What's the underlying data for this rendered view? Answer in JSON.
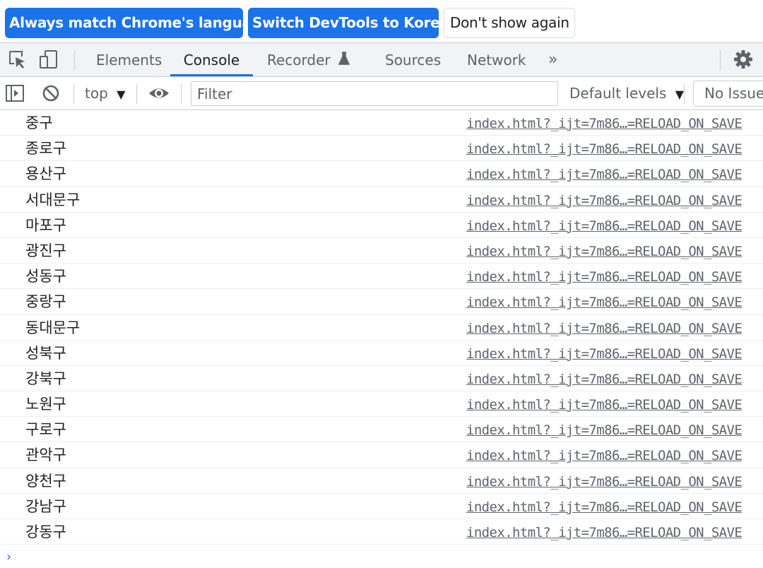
{
  "infobar": {
    "match_label": "Always match Chrome's language",
    "switch_label": "Switch DevTools to Korean",
    "dont_show_label": "Don't show again"
  },
  "tabbar": {
    "tabs": [
      {
        "label": "Elements"
      },
      {
        "label": "Console"
      },
      {
        "label": "Recorder"
      },
      {
        "label": "Sources"
      },
      {
        "label": "Network"
      }
    ],
    "more_label": "»",
    "active_tab": "Console",
    "icons": [
      "inspect-element-icon",
      "device-toolbar-icon",
      "flask-icon",
      "gear-icon"
    ]
  },
  "console_toolbar": {
    "context": "top",
    "filter_placeholder": "Filter",
    "levels_label": "Default levels",
    "issues_label": "No Issues",
    "icons": [
      "sidebar-toggle-icon",
      "clear-console-icon",
      "dropdown-caret-icon",
      "eye-icon"
    ]
  },
  "log": {
    "source_link": "index.html?_ijt=7m86…=RELOAD_ON_SAVE",
    "messages": [
      "중구",
      "종로구",
      "용산구",
      "서대문구",
      "마포구",
      "광진구",
      "성동구",
      "중랑구",
      "동대문구",
      "성북구",
      "강북구",
      "노원구",
      "구로구",
      "관악구",
      "양천구",
      "강남구",
      "강동구"
    ]
  },
  "prompt_symbol": "›",
  "colors": {
    "accent": "#1a73e8",
    "toolbar_bg": "#f1f3f4",
    "text": "#202124",
    "muted": "#5f6368",
    "border": "#cacdd1"
  }
}
